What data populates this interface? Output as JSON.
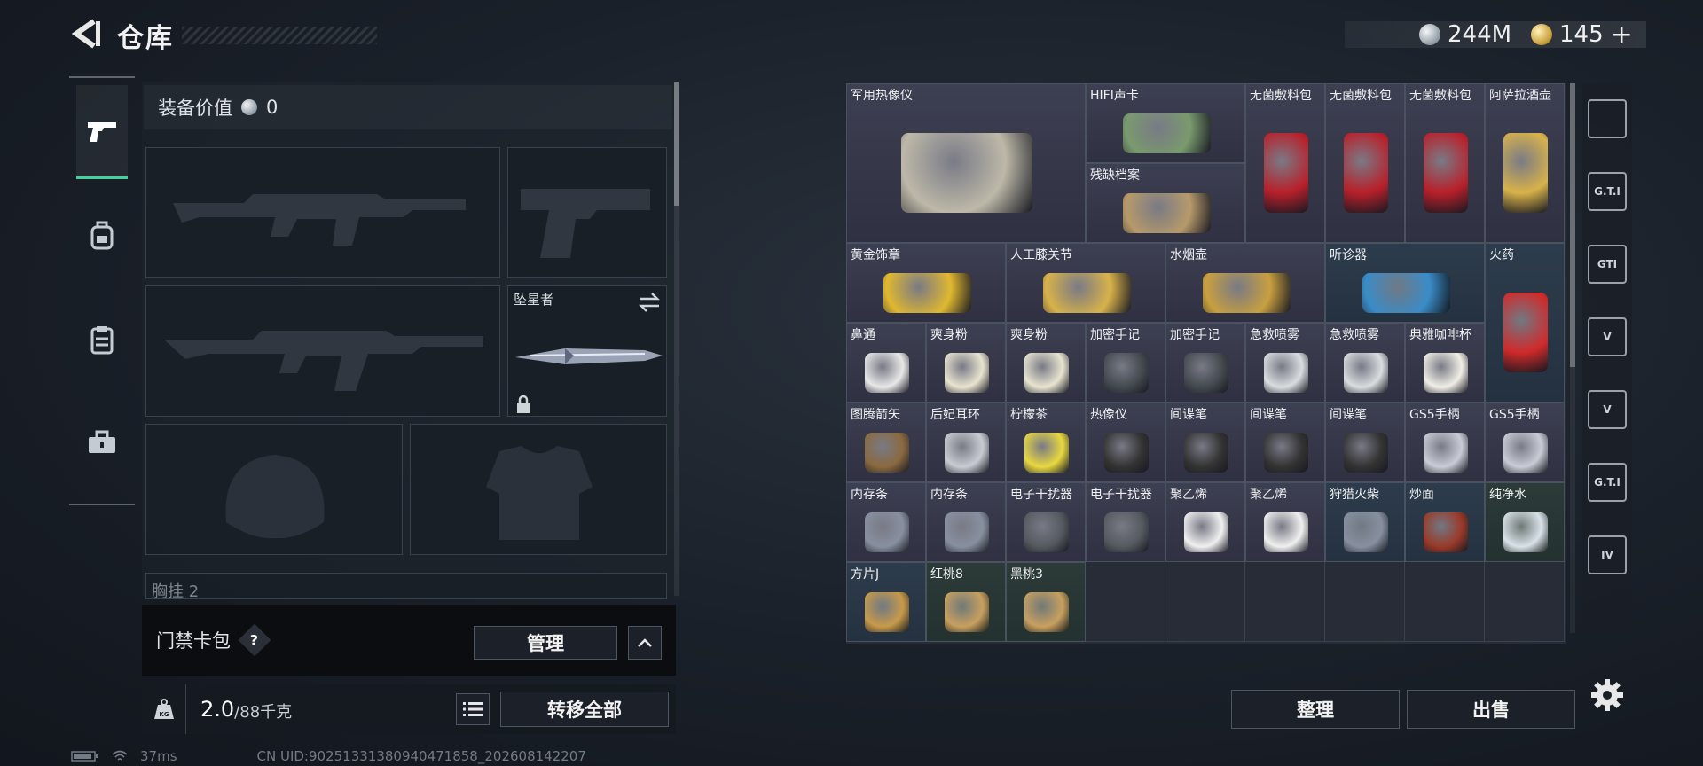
{
  "header": {
    "title": "仓库",
    "currency_silver": "244M",
    "currency_gold": "145",
    "gold_plus": "+"
  },
  "tabs": [
    {
      "icon": "pistol-icon",
      "active": true
    },
    {
      "icon": "backpack-icon",
      "active": false
    },
    {
      "icon": "vest-icon",
      "active": false
    },
    {
      "icon": "toolbox-icon",
      "active": false
    }
  ],
  "equipment": {
    "value_label": "装备价值",
    "value": "0",
    "melee_slot_label": "坠星者",
    "chest_label_partial": "胸挂 2"
  },
  "cardpack": {
    "label": "门禁卡包",
    "help": "?",
    "manage": "管理"
  },
  "weight": {
    "current": "2.0",
    "max": "/88千克",
    "transfer_all": "转移全部",
    "kg_icon": "KG"
  },
  "status": {
    "ping": "37ms",
    "uid": "CN UID:90251331380940471858_202608142207"
  },
  "inventory": {
    "items": [
      {
        "name": "军用热像仪",
        "rarity": "r-purple"
      },
      {
        "name": "HIFI声卡",
        "rarity": "r-purple"
      },
      {
        "name": "残缺档案",
        "rarity": "r-purple"
      },
      {
        "name": "无菌敷料包",
        "rarity": "r-purple"
      },
      {
        "name": "无菌敷料包",
        "rarity": "r-purple"
      },
      {
        "name": "无菌敷料包",
        "rarity": "r-purple"
      },
      {
        "name": "阿萨拉酒壶",
        "rarity": "r-purple"
      },
      {
        "name": "黄金饰章",
        "rarity": "r-purple"
      },
      {
        "name": "人工膝关节",
        "rarity": "r-purple"
      },
      {
        "name": "水烟壶",
        "rarity": "r-purple"
      },
      {
        "name": "听诊器",
        "rarity": "r-blue"
      },
      {
        "name": "火药",
        "rarity": "r-blue"
      },
      {
        "name": "鼻通",
        "rarity": "r-purple"
      },
      {
        "name": "爽身粉",
        "rarity": "r-purple"
      },
      {
        "name": "爽身粉",
        "rarity": "r-purple"
      },
      {
        "name": "加密手记",
        "rarity": "r-purple"
      },
      {
        "name": "加密手记",
        "rarity": "r-purple"
      },
      {
        "name": "急救喷雾",
        "rarity": "r-purple"
      },
      {
        "name": "急救喷雾",
        "rarity": "r-purple"
      },
      {
        "name": "典雅咖啡杯",
        "rarity": "r-purple"
      },
      {
        "name": "图腾箭矢",
        "rarity": "r-purple"
      },
      {
        "name": "后妃耳环",
        "rarity": "r-purple"
      },
      {
        "name": "柠檬茶",
        "rarity": "r-purple"
      },
      {
        "name": "热像仪",
        "rarity": "r-purple"
      },
      {
        "name": "间谍笔",
        "rarity": "r-purple"
      },
      {
        "name": "间谍笔",
        "rarity": "r-purple"
      },
      {
        "name": "间谍笔",
        "rarity": "r-purple"
      },
      {
        "name": "GS5手柄",
        "rarity": "r-purple"
      },
      {
        "name": "GS5手柄",
        "rarity": "r-purple"
      },
      {
        "name": "内存条",
        "rarity": "r-purple"
      },
      {
        "name": "内存条",
        "rarity": "r-purple"
      },
      {
        "name": "电子干扰器",
        "rarity": "r-purple"
      },
      {
        "name": "电子干扰器",
        "rarity": "r-purple"
      },
      {
        "name": "聚乙烯",
        "rarity": "r-purple"
      },
      {
        "name": "聚乙烯",
        "rarity": "r-purple"
      },
      {
        "name": "狩猎火柴",
        "rarity": "r-blue"
      },
      {
        "name": "炒面",
        "rarity": "r-blue"
      },
      {
        "name": "纯净水",
        "rarity": "r-green"
      },
      {
        "name": "方片J",
        "rarity": "r-blue"
      },
      {
        "name": "红桃8",
        "rarity": "r-green"
      },
      {
        "name": "黑桃3",
        "rarity": "r-green"
      }
    ]
  },
  "right_bar": [
    {
      "icon": "gate-icon",
      "text": ""
    },
    {
      "icon": "gti-gun-icon",
      "text": "G.T.I"
    },
    {
      "icon": "gti-map-icon",
      "text": "GTI"
    },
    {
      "icon": "v-case-icon",
      "text": "V"
    },
    {
      "icon": "v-box-icon",
      "text": "V"
    },
    {
      "icon": "gti-hand-icon",
      "text": "G.T.I"
    },
    {
      "icon": "iv-add-icon",
      "text": "IV"
    }
  ],
  "actions": {
    "sort": "整理",
    "sell": "出售"
  },
  "colors": {
    "accent_green": "#3fd39a",
    "rarity_purple": "#3d3f52",
    "rarity_blue": "#2d3c4c",
    "rarity_green": "#2c3b38"
  }
}
